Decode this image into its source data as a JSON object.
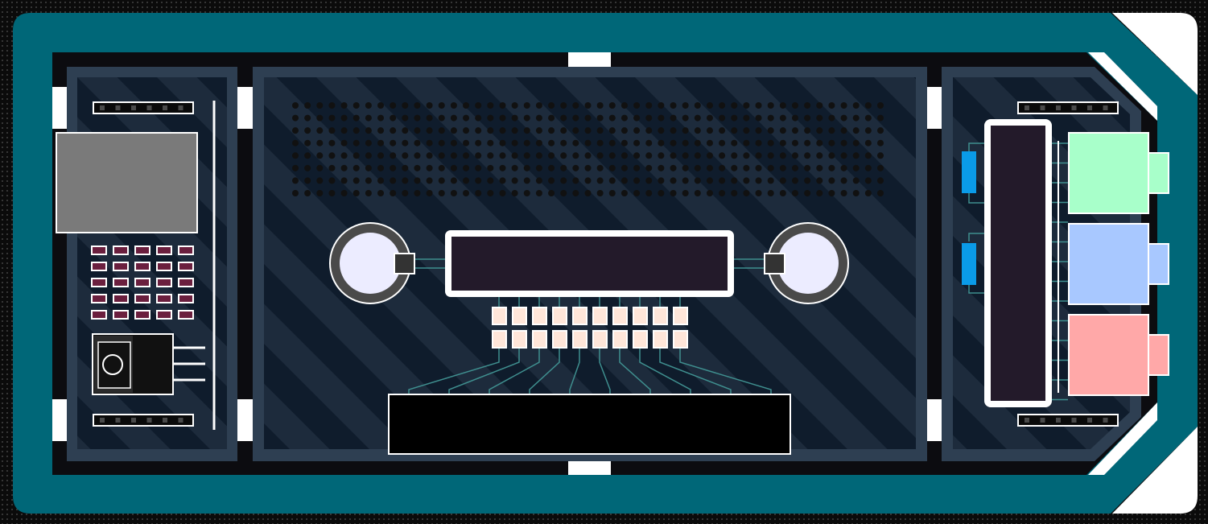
{
  "board": {
    "frame_color": "#006778",
    "panel_color": "#2e3f52",
    "inner_color": "#0f1c2c",
    "stripe_color": "#1d2b3c",
    "outline_color": "#ffffff"
  },
  "left_module": {
    "display_color": "#7a7a7a",
    "keypad": {
      "rows": 5,
      "cols": 5,
      "key_color": "#6b1f3e"
    },
    "regulator_icon": "voltage-regulator-icon",
    "header_pins": 6
  },
  "center_module": {
    "speaker_grille": {
      "rows": 8,
      "cols": 49
    },
    "lcd_color": "#231a2a",
    "led_color": "#ffe6d9",
    "led_rows": 2,
    "led_cols": 10,
    "button_color": "#ececff",
    "connector_color": "#000000"
  },
  "right_module": {
    "chip_color": "#231a2a",
    "resistor_color": "#0a9be8",
    "keys": [
      {
        "name": "green-key",
        "color": "#a8ffca"
      },
      {
        "name": "blue-key",
        "color": "#a8c8ff"
      },
      {
        "name": "red-key",
        "color": "#ffa8a8"
      }
    ],
    "header_pins": 6
  }
}
